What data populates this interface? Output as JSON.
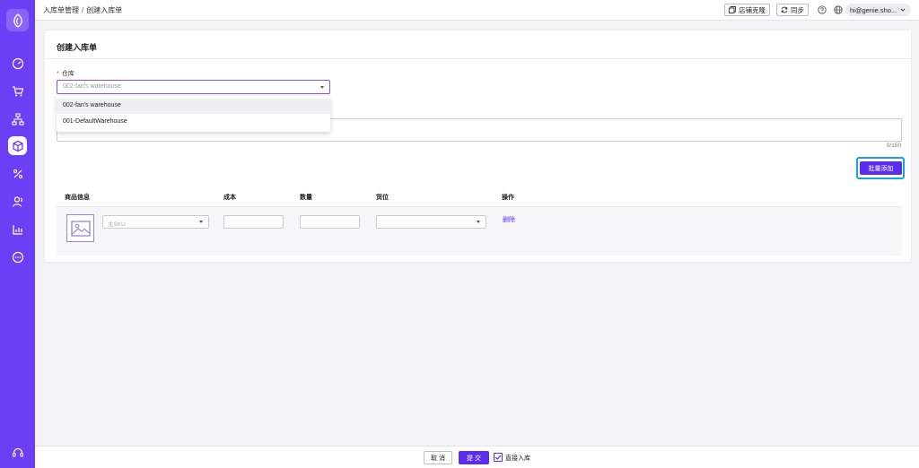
{
  "breadcrumb": {
    "parent": "入库单管理",
    "separator": "/",
    "current": "创建入库单"
  },
  "topbar": {
    "clone_label": "店铺克隆",
    "sync_label": "同步",
    "user_email": "hi@genie.sho..."
  },
  "sidebar": {
    "items": [
      {
        "icon": "dashboard-icon"
      },
      {
        "icon": "cart-icon"
      },
      {
        "icon": "sitemap-icon"
      },
      {
        "icon": "box-icon",
        "active": true
      },
      {
        "icon": "percent-icon"
      },
      {
        "icon": "users-icon"
      },
      {
        "icon": "chart-icon"
      },
      {
        "icon": "chat-icon"
      }
    ],
    "support_icon": "headset-icon"
  },
  "form": {
    "title": "创建入库单",
    "warehouse_label": "仓库",
    "warehouse_placeholder": "002-fan's warehouse",
    "warehouse_options": [
      "002-fan's warehouse",
      "001-DefaultWarehouse"
    ],
    "note_counter": "0/150",
    "batch_add_label": "批量添加"
  },
  "table": {
    "headers": [
      "商品信息",
      "成本",
      "数量",
      "货位",
      "操作"
    ],
    "row": {
      "sku_placeholder": "主SKU",
      "delete_label": "删除"
    }
  },
  "footer": {
    "cancel_label": "取 消",
    "submit_label": "提 交",
    "direct_label": "直接入库",
    "direct_checked": true
  },
  "colors": {
    "brand": "#6b3ff5",
    "primary_button": "#5a2df0",
    "focus_ring": "#1aa3e0"
  }
}
